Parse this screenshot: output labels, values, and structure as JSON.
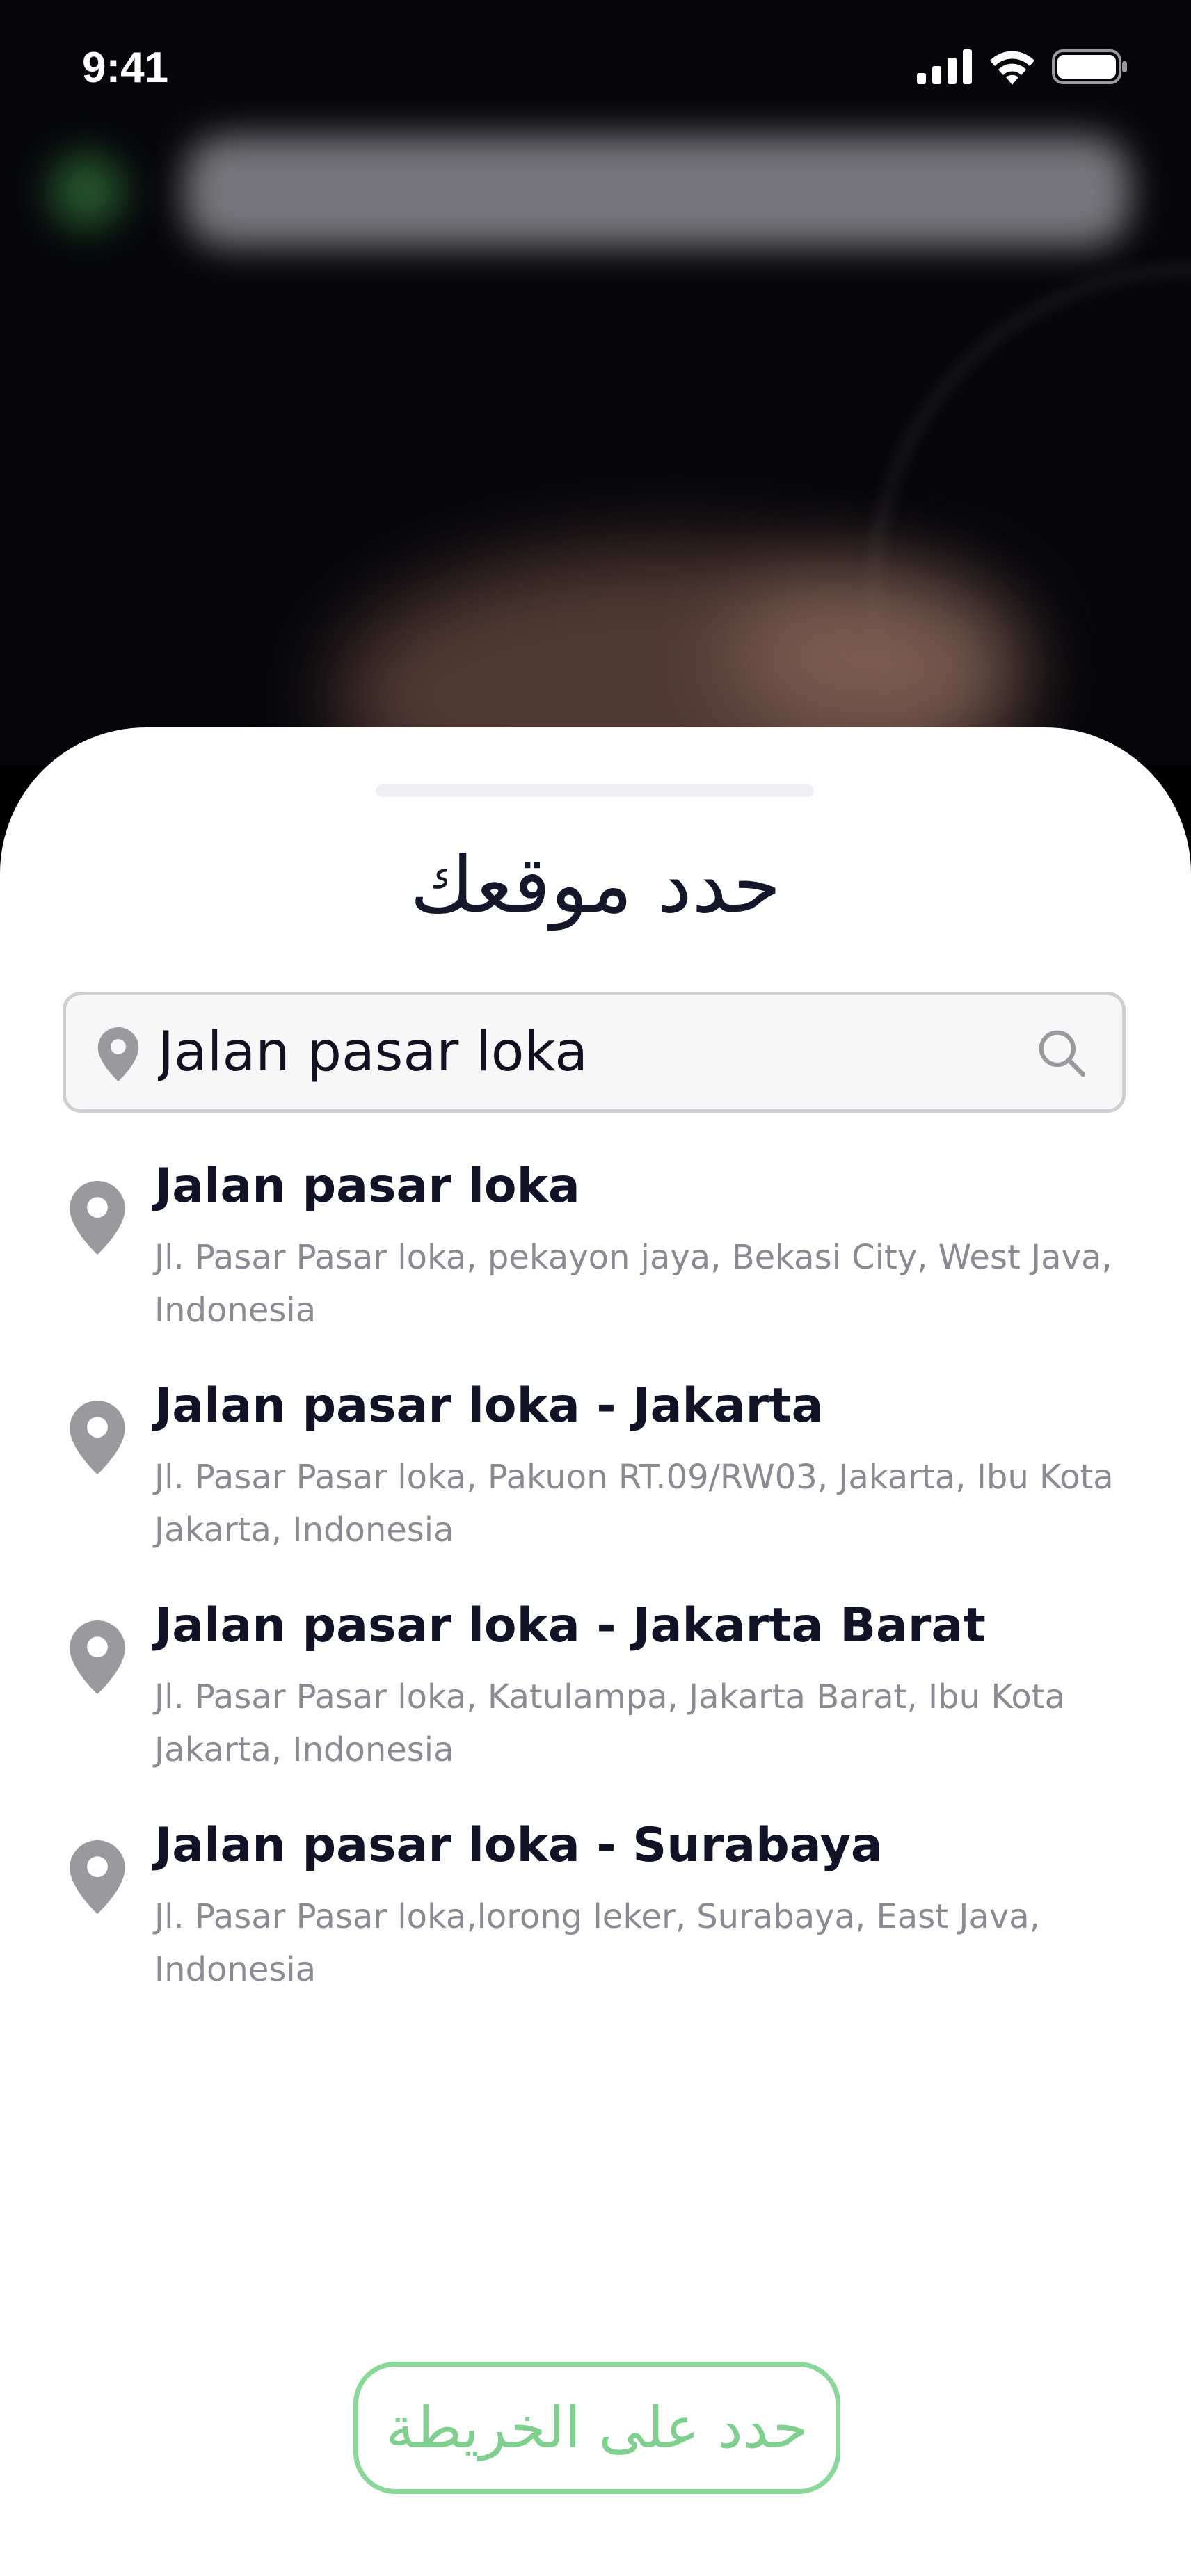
{
  "status_bar": {
    "time": "9:41",
    "icons": [
      "signal-icon",
      "wifi-icon",
      "battery-icon"
    ]
  },
  "sheet": {
    "title": "حدد موقعك",
    "search": {
      "value": "Jalan pasar loka",
      "placeholder": "",
      "leading_icon": "location-pin-icon",
      "trailing_icon": "search-icon"
    },
    "results": [
      {
        "title": "Jalan pasar loka",
        "address": "Jl. Pasar Pasar loka, pekayon jaya, Bekasi City, West Java, Indonesia",
        "icon": "location-pin-icon"
      },
      {
        "title": "Jalan pasar loka - Jakarta",
        "address": "Jl. Pasar Pasar loka, Pakuon RT.09/RW03, Jakarta, Ibu Kota Jakarta, Indonesia",
        "icon": "location-pin-icon"
      },
      {
        "title": "Jalan pasar loka - Jakarta Barat",
        "address": "Jl. Pasar Pasar loka, Katulampa, Jakarta Barat, Ibu Kota Jakarta, Indonesia",
        "icon": "location-pin-icon"
      },
      {
        "title": "Jalan pasar loka - Surabaya",
        "address": "Jl. Pasar Pasar loka,lorong leker, Surabaya, East Java, Indonesia",
        "icon": "location-pin-icon"
      }
    ],
    "map_button_label": "حدد على الخريطة"
  },
  "colors": {
    "accent_green": "#7fd08f",
    "title_text": "#16162a",
    "secondary_text": "#8a8a92",
    "pin_gray": "#9a9a9e"
  }
}
